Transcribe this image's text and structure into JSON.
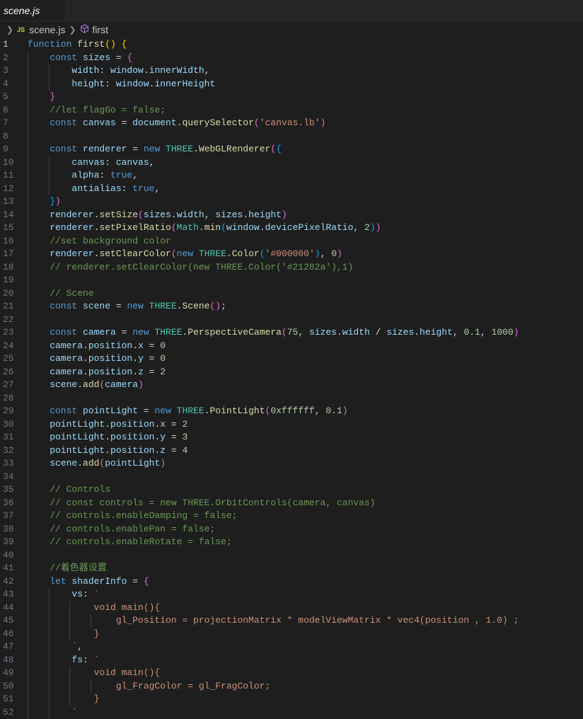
{
  "tab": {
    "title": "scene.js"
  },
  "breadcrumb": {
    "file_badge": "JS",
    "file": "scene.js",
    "symbol": "first"
  },
  "lines": [
    [
      [
        "k",
        "function "
      ],
      [
        "f",
        "first"
      ],
      [
        "b1",
        "() {"
      ]
    ],
    [
      [
        "k",
        "    const "
      ],
      [
        "v",
        "sizes"
      ],
      [
        "p",
        " = "
      ],
      [
        "b2",
        "{"
      ]
    ],
    [
      [
        "v",
        "        width"
      ],
      [
        "p",
        ": "
      ],
      [
        "v",
        "window"
      ],
      [
        "p",
        "."
      ],
      [
        "v",
        "innerWidth"
      ],
      [
        "p",
        ","
      ]
    ],
    [
      [
        "v",
        "        height"
      ],
      [
        "p",
        ": "
      ],
      [
        "v",
        "window"
      ],
      [
        "p",
        "."
      ],
      [
        "v",
        "innerHeight"
      ]
    ],
    [
      [
        "b2",
        "    }"
      ]
    ],
    [
      [
        "c",
        "    //let flagGo = false;"
      ]
    ],
    [
      [
        "k",
        "    const "
      ],
      [
        "v",
        "canvas"
      ],
      [
        "p",
        " = "
      ],
      [
        "v",
        "document"
      ],
      [
        "p",
        "."
      ],
      [
        "f",
        "querySelector"
      ],
      [
        "b2",
        "("
      ],
      [
        "s",
        "'canvas.lb'"
      ],
      [
        "b2",
        ")"
      ]
    ],
    [],
    [
      [
        "k",
        "    const "
      ],
      [
        "v",
        "renderer"
      ],
      [
        "p",
        " = "
      ],
      [
        "k",
        "new "
      ],
      [
        "t",
        "THREE"
      ],
      [
        "p",
        "."
      ],
      [
        "f",
        "WebGLRenderer"
      ],
      [
        "b2",
        "("
      ],
      [
        "b3",
        "{"
      ]
    ],
    [
      [
        "v",
        "        canvas"
      ],
      [
        "p",
        ": "
      ],
      [
        "v",
        "canvas"
      ],
      [
        "p",
        ","
      ]
    ],
    [
      [
        "v",
        "        alpha"
      ],
      [
        "p",
        ": "
      ],
      [
        "k",
        "true"
      ],
      [
        "p",
        ","
      ]
    ],
    [
      [
        "v",
        "        antialias"
      ],
      [
        "p",
        ": "
      ],
      [
        "k",
        "true"
      ],
      [
        "p",
        ","
      ]
    ],
    [
      [
        "b3",
        "    }"
      ],
      [
        "b2",
        ")"
      ]
    ],
    [
      [
        "v",
        "    renderer"
      ],
      [
        "p",
        "."
      ],
      [
        "f",
        "setSize"
      ],
      [
        "b2",
        "("
      ],
      [
        "v",
        "sizes"
      ],
      [
        "p",
        "."
      ],
      [
        "v",
        "width"
      ],
      [
        "p",
        ", "
      ],
      [
        "v",
        "sizes"
      ],
      [
        "p",
        "."
      ],
      [
        "v",
        "height"
      ],
      [
        "b2",
        ")"
      ]
    ],
    [
      [
        "v",
        "    renderer"
      ],
      [
        "p",
        "."
      ],
      [
        "f",
        "setPixelRatio"
      ],
      [
        "b2",
        "("
      ],
      [
        "t",
        "Math"
      ],
      [
        "p",
        "."
      ],
      [
        "f",
        "min"
      ],
      [
        "b3",
        "("
      ],
      [
        "v",
        "window"
      ],
      [
        "p",
        "."
      ],
      [
        "v",
        "devicePixelRatio"
      ],
      [
        "p",
        ", "
      ],
      [
        "n",
        "2"
      ],
      [
        "b3",
        ")"
      ],
      [
        "b2",
        ")"
      ]
    ],
    [
      [
        "c",
        "    //set background color"
      ]
    ],
    [
      [
        "v",
        "    renderer"
      ],
      [
        "p",
        "."
      ],
      [
        "f",
        "setClearColor"
      ],
      [
        "b2",
        "("
      ],
      [
        "k",
        "new "
      ],
      [
        "t",
        "THREE"
      ],
      [
        "p",
        "."
      ],
      [
        "f",
        "Color"
      ],
      [
        "b3",
        "("
      ],
      [
        "s",
        "'#000000'"
      ],
      [
        "b3",
        ")"
      ],
      [
        "p",
        ", "
      ],
      [
        "n",
        "0"
      ],
      [
        "b2",
        ")"
      ]
    ],
    [
      [
        "c",
        "    // renderer.setClearColor(new THREE.Color('#21282a'),1)"
      ]
    ],
    [],
    [
      [
        "c",
        "    // Scene"
      ]
    ],
    [
      [
        "k",
        "    const "
      ],
      [
        "v",
        "scene"
      ],
      [
        "p",
        " = "
      ],
      [
        "k",
        "new "
      ],
      [
        "t",
        "THREE"
      ],
      [
        "p",
        "."
      ],
      [
        "f",
        "Scene"
      ],
      [
        "b2",
        "()"
      ],
      [
        "p",
        ";"
      ]
    ],
    [],
    [
      [
        "k",
        "    const "
      ],
      [
        "v",
        "camera"
      ],
      [
        "p",
        " = "
      ],
      [
        "k",
        "new "
      ],
      [
        "t",
        "THREE"
      ],
      [
        "p",
        "."
      ],
      [
        "f",
        "PerspectiveCamera"
      ],
      [
        "b2",
        "("
      ],
      [
        "n",
        "75"
      ],
      [
        "p",
        ", "
      ],
      [
        "v",
        "sizes"
      ],
      [
        "p",
        "."
      ],
      [
        "v",
        "width"
      ],
      [
        "p",
        " / "
      ],
      [
        "v",
        "sizes"
      ],
      [
        "p",
        "."
      ],
      [
        "v",
        "height"
      ],
      [
        "p",
        ", "
      ],
      [
        "n",
        "0.1"
      ],
      [
        "p",
        ", "
      ],
      [
        "n",
        "1000"
      ],
      [
        "b2",
        ")"
      ]
    ],
    [
      [
        "v",
        "    camera"
      ],
      [
        "p",
        "."
      ],
      [
        "v",
        "position"
      ],
      [
        "p",
        "."
      ],
      [
        "v",
        "x"
      ],
      [
        "p",
        " = "
      ],
      [
        "n",
        "0"
      ]
    ],
    [
      [
        "v",
        "    camera"
      ],
      [
        "p",
        "."
      ],
      [
        "v",
        "position"
      ],
      [
        "p",
        "."
      ],
      [
        "v",
        "y"
      ],
      [
        "p",
        " = "
      ],
      [
        "n",
        "0"
      ]
    ],
    [
      [
        "v",
        "    camera"
      ],
      [
        "p",
        "."
      ],
      [
        "v",
        "position"
      ],
      [
        "p",
        "."
      ],
      [
        "v",
        "z"
      ],
      [
        "p",
        " = "
      ],
      [
        "n",
        "2"
      ]
    ],
    [
      [
        "v",
        "    scene"
      ],
      [
        "p",
        "."
      ],
      [
        "f",
        "add"
      ],
      [
        "b2",
        "("
      ],
      [
        "v",
        "camera"
      ],
      [
        "b2",
        ")"
      ]
    ],
    [],
    [
      [
        "k",
        "    const "
      ],
      [
        "v",
        "pointLight"
      ],
      [
        "p",
        " = "
      ],
      [
        "k",
        "new "
      ],
      [
        "t",
        "THREE"
      ],
      [
        "p",
        "."
      ],
      [
        "f",
        "PointLight"
      ],
      [
        "b2",
        "("
      ],
      [
        "n",
        "0xffffff"
      ],
      [
        "p",
        ", "
      ],
      [
        "n",
        "0.1"
      ],
      [
        "b2",
        ")"
      ]
    ],
    [
      [
        "v",
        "    pointLight"
      ],
      [
        "p",
        "."
      ],
      [
        "v",
        "position"
      ],
      [
        "p",
        "."
      ],
      [
        "v",
        "x"
      ],
      [
        "p",
        " = "
      ],
      [
        "n",
        "2"
      ]
    ],
    [
      [
        "v",
        "    pointLight"
      ],
      [
        "p",
        "."
      ],
      [
        "v",
        "position"
      ],
      [
        "p",
        "."
      ],
      [
        "v",
        "y"
      ],
      [
        "p",
        " = "
      ],
      [
        "n",
        "3"
      ]
    ],
    [
      [
        "v",
        "    pointLight"
      ],
      [
        "p",
        "."
      ],
      [
        "v",
        "position"
      ],
      [
        "p",
        "."
      ],
      [
        "v",
        "z"
      ],
      [
        "p",
        " = "
      ],
      [
        "n",
        "4"
      ]
    ],
    [
      [
        "v",
        "    scene"
      ],
      [
        "p",
        "."
      ],
      [
        "f",
        "add"
      ],
      [
        "b2",
        "("
      ],
      [
        "v",
        "pointLight"
      ],
      [
        "b2",
        ")"
      ]
    ],
    [],
    [
      [
        "c",
        "    // Controls"
      ]
    ],
    [
      [
        "c",
        "    // const controls = new THREE.OrbitControls(camera, canvas)"
      ]
    ],
    [
      [
        "c",
        "    // controls.enableDamping = false;"
      ]
    ],
    [
      [
        "c",
        "    // controls.enablePan = false;"
      ]
    ],
    [
      [
        "c",
        "    // controls.enableRotate = false;"
      ]
    ],
    [],
    [
      [
        "c",
        "    //着色器设置"
      ]
    ],
    [
      [
        "k",
        "    let "
      ],
      [
        "v",
        "shaderInfo"
      ],
      [
        "p",
        " = "
      ],
      [
        "b2",
        "{"
      ]
    ],
    [
      [
        "v",
        "        vs"
      ],
      [
        "p",
        ": "
      ],
      [
        "s",
        "`"
      ]
    ],
    [
      [
        "s",
        "            void main(){"
      ]
    ],
    [
      [
        "s",
        "                gl_Position = projectionMatrix * modelViewMatrix * vec4(position , 1.0) ;"
      ]
    ],
    [
      [
        "s",
        "            }"
      ]
    ],
    [
      [
        "s",
        "        `"
      ],
      [
        "p",
        ","
      ]
    ],
    [
      [
        "v",
        "        fs"
      ],
      [
        "p",
        ": "
      ],
      [
        "s",
        "`"
      ]
    ],
    [
      [
        "s",
        "            void main(){"
      ]
    ],
    [
      [
        "s",
        "                gl_FragColor = gl_FragColor;"
      ]
    ],
    [
      [
        "s",
        "            }"
      ]
    ],
    [
      [
        "s",
        "        `"
      ]
    ]
  ]
}
